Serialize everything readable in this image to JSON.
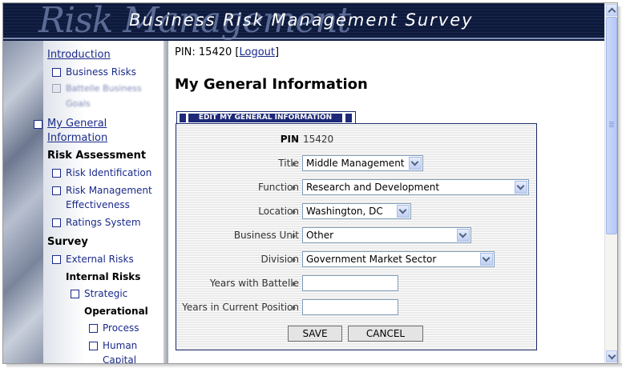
{
  "header": {
    "logo_text": "Risk Management",
    "title": "Business Risk Management Survey"
  },
  "sidebar": {
    "introduction": "Introduction",
    "business_risks": "Business Risks",
    "battelle_goals_line1": "Battelle Business",
    "battelle_goals_line2": "Goals",
    "general_info_line1": "My General",
    "general_info_line2": "Information",
    "risk_assessment": "Risk Assessment",
    "risk_identification": "Risk Identification",
    "rm_effectiveness_line1": "Risk Management",
    "rm_effectiveness_line2": "Effectiveness",
    "ratings_system": "Ratings System",
    "survey": "Survey",
    "external_risks": "External Risks",
    "internal_risks": "Internal Risks",
    "strategic": "Strategic",
    "operational": "Operational",
    "process": "Process",
    "human_capital_line1": "Human",
    "human_capital_line2": "Capital"
  },
  "main": {
    "pin_prefix": "PIN: 15420",
    "logout": "Logout",
    "page_title": "My General Information",
    "tab_label": "EDIT MY GENERAL INFORMATION"
  },
  "form": {
    "pin_label": "PIN",
    "pin_value": "15420",
    "title_label": "Title",
    "title_value": "Middle Management",
    "function_label": "Function",
    "function_value": "Research and Development",
    "location_label": "Location",
    "location_value": "Washington, DC",
    "business_unit_label": "Business Unit",
    "business_unit_value": "Other",
    "division_label": "Division",
    "division_value": "Government Market Sector",
    "years_battelle_label": "Years with Battelle",
    "years_battelle_value": "",
    "years_position_label": "Years in Current Position",
    "years_position_value": "",
    "save_label": "SAVE",
    "cancel_label": "CANCEL"
  }
}
